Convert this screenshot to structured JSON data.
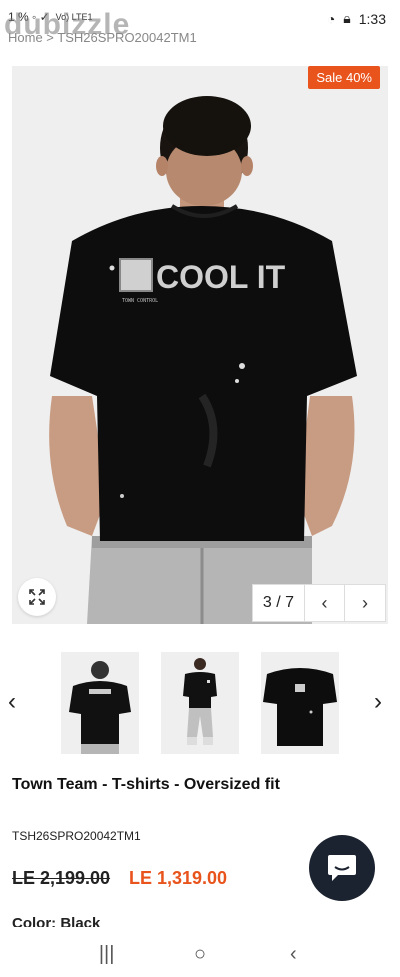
{
  "status_bar": {
    "left_text": "1 % ◦ ✓",
    "network": "Vo) LTE1",
    "time": "1:33"
  },
  "brand": {
    "name": "dubizzle"
  },
  "breadcrumb": {
    "text": "Home > TSH26SPRO20042TM1"
  },
  "product": {
    "sale_badge": "Sale 40%",
    "pager": {
      "count": "3 / 7",
      "prev": "‹",
      "next": "›"
    },
    "title": "Town Team - T-shirts - Oversized fit",
    "sku": "TSH26SPRO20042TM1",
    "price_old": "LE 2,199.00",
    "price_new": "LE 1,319.00",
    "color_label": "Color: Black",
    "shirt_print": "COOL IT",
    "shirt_patch": "TOWN CONTROL"
  },
  "thumbnails": {
    "prev": "‹",
    "next": "›",
    "items": [
      "back",
      "full-body",
      "flat-back"
    ]
  },
  "colors": {
    "accent": "#e8541c",
    "shirt": "#0d0d0d",
    "chat": "#1c2330"
  },
  "nav": {
    "recent": "|||",
    "home": "○",
    "back": "‹"
  }
}
